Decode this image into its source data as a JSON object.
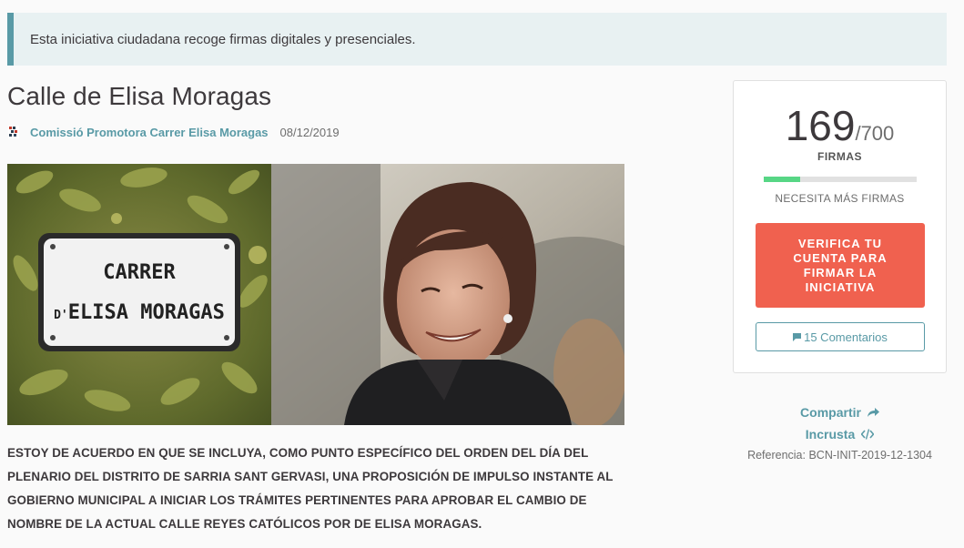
{
  "callout": {
    "text": "Esta iniciativa ciudadana recoge firmas digitales y presenciales."
  },
  "initiative": {
    "title": "Calle de Elisa Moragas",
    "author": "Comissió Promotora Carrer Elisa Moragas",
    "date": "08/12/2019",
    "body": "ESTOY DE ACUERDO EN QUE SE INCLUYA, COMO PUNTO ESPECÍFICO DEL ORDEN DEL DÍA DEL PLENARIO DEL DISTRITO DE SARRIA SANT GERVASI, UNA PROPOSICIÓN DE IMPULSO INSTANTE AL GOBIERNO MUNICIPAL A INICIAR LOS TRÁMITES PERTINENTES PARA APROBAR EL CAMBIO DE NOMBRE DE LA ACTUAL CALLE REYES CATÓLICOS POR DE ELISA MORAGAS."
  },
  "image": {
    "sign_line1": "CARRER",
    "sign_line2_prefix": "D'",
    "sign_line2": "ELISA MORAGAS"
  },
  "signatures": {
    "current": "169",
    "total": "/700",
    "label": "FIRMAS",
    "progress": 0.241,
    "needs_label": "NECESITA MÁS FIRMAS"
  },
  "actions": {
    "verify_label": "VERIFICA TU CUENTA PARA FIRMAR LA INICIATIVA",
    "comments_label": "15 Comentarios",
    "share_label": "Compartir",
    "embed_label": "Incrusta",
    "reference": "Referencia: BCN-INIT-2019-12-1304"
  },
  "colors": {
    "accent": "#599aa6",
    "verify": "#f0614f",
    "progress": "#57d685",
    "callout_bg": "#e8f1f2"
  },
  "icons": {
    "share": "share-arrow-icon",
    "embed": "code-icon",
    "comments": "chat-bubble-icon",
    "avatar": "organization-avatar"
  }
}
